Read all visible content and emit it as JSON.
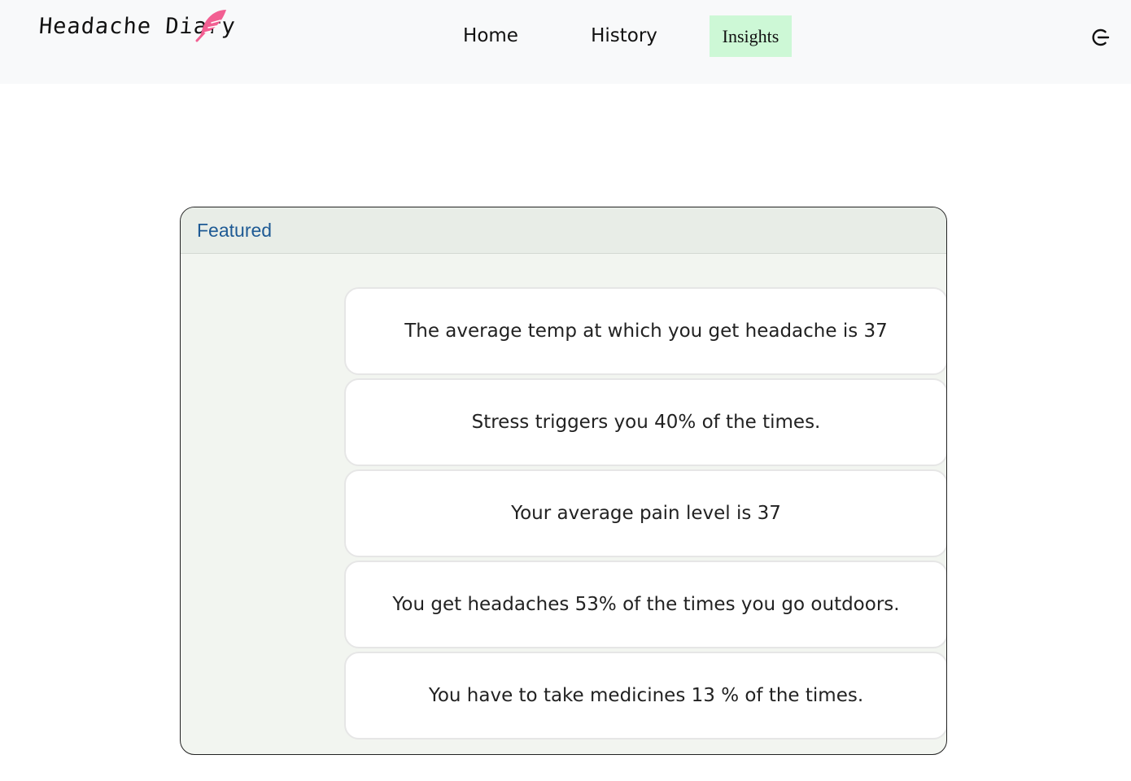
{
  "navbar": {
    "brand": "Headache Diary",
    "items": [
      {
        "label": "Home"
      },
      {
        "label": "History"
      },
      {
        "label": "Insights",
        "active": true
      }
    ],
    "logout_icon": "logout-icon",
    "feather_color": "#f25f92",
    "active_bg": "#cdf8d6"
  },
  "card": {
    "header": "Featured",
    "header_color": "#1e5a94",
    "insights": [
      "The average temp at which you get headache is 37",
      "Stress triggers you 40% of the times.",
      "Your average pain level is 37",
      "You get headaches 53% of the times you go outdoors.",
      "You have to take medicines 13 % of the times."
    ]
  }
}
